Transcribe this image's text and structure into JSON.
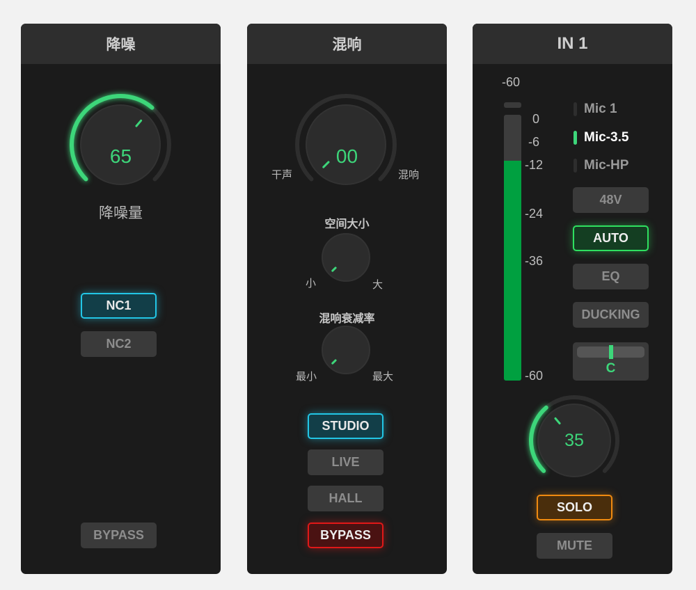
{
  "colors": {
    "accent_green": "#3dd67a",
    "cyan": "#22c6e6",
    "red": "#e01818",
    "orange": "#f08a10"
  },
  "panels": {
    "nr": {
      "title": "降噪",
      "knob": {
        "value": 65,
        "display": "65",
        "label": "降噪量"
      },
      "modes": [
        "NC1",
        "NC2"
      ],
      "active_mode": "NC1",
      "bypass": "BYPASS"
    },
    "reverb": {
      "title": "混响",
      "mix_knob": {
        "value": 0,
        "display": "00",
        "min_label": "干声",
        "max_label": "混响"
      },
      "size_knob": {
        "title": "空间大小",
        "value": 0,
        "min_label": "小",
        "max_label": "大"
      },
      "decay_knob": {
        "title": "混响衰减率",
        "value": 0,
        "min_label": "最小",
        "max_label": "最大"
      },
      "presets": [
        "STUDIO",
        "LIVE",
        "HALL"
      ],
      "active_preset": "STUDIO",
      "bypass": "BYPASS",
      "bypass_active": true
    },
    "input": {
      "title": "IN 1",
      "peak_label": "-60",
      "meter_scale": [
        "0",
        "-6",
        "-12",
        "-24",
        "-36",
        "-60"
      ],
      "meter_level_db": -12,
      "sources": [
        {
          "label": "Mic 1",
          "active": false
        },
        {
          "label": "Mic-3.5",
          "active": true
        },
        {
          "label": "Mic-HP",
          "active": false
        }
      ],
      "buttons": {
        "phantom": "48V",
        "auto": "AUTO",
        "eq": "EQ",
        "ducking": "DUCKING"
      },
      "auto_active": true,
      "pan": {
        "label": "C",
        "value": 0
      },
      "gain_knob": {
        "value": 35,
        "display": "35"
      },
      "solo": "SOLO",
      "mute": "MUTE",
      "solo_active": true
    }
  }
}
